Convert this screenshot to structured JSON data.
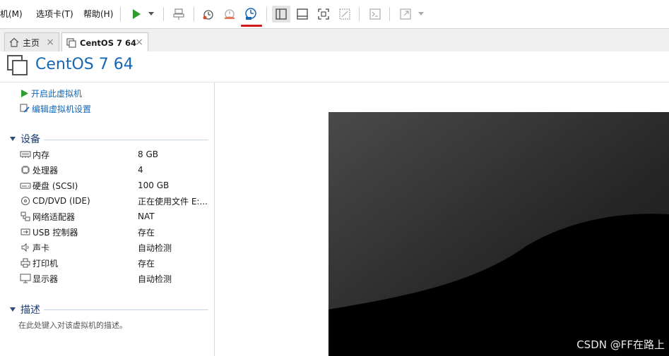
{
  "menu": {
    "vm": "机(M)",
    "tabs": "选项卡(T)",
    "help": "帮助(H)"
  },
  "toolbar": {
    "icons": [
      "play-icon",
      "suspend-icon",
      "snapshot-icon",
      "revert-snapshot-icon",
      "snapshot-manager-icon",
      "show-library-icon",
      "thumbnail-bar-icon",
      "fullscreen-icon",
      "unity-icon",
      "console-icon",
      "stretch-icon"
    ],
    "highlight_color": "#d01818"
  },
  "tabs": [
    {
      "label": "主页",
      "icon": "home-icon",
      "active": false
    },
    {
      "label": "CentOS 7 64",
      "icon": "vm-icon",
      "active": true
    }
  ],
  "vm": {
    "title": "CentOS 7 64",
    "title_color": "#1466b6"
  },
  "actions": {
    "power_on": "开启此虚拟机",
    "edit_settings": "编辑虚拟机设置"
  },
  "devices": {
    "heading": "设备",
    "items": [
      {
        "name": "内存",
        "value": "8 GB",
        "icon": "memory-icon"
      },
      {
        "name": "处理器",
        "value": "4",
        "icon": "cpu-icon"
      },
      {
        "name": "硬盘 (SCSI)",
        "value": "100 GB",
        "icon": "harddisk-icon"
      },
      {
        "name": "CD/DVD (IDE)",
        "value": "正在使用文件 E:...",
        "icon": "cdrom-icon"
      },
      {
        "name": "网络适配器",
        "value": "NAT",
        "icon": "network-icon"
      },
      {
        "name": "USB 控制器",
        "value": "存在",
        "icon": "usb-icon"
      },
      {
        "name": "声卡",
        "value": "自动检测",
        "icon": "sound-icon"
      },
      {
        "name": "打印机",
        "value": "存在",
        "icon": "printer-icon"
      },
      {
        "name": "显示器",
        "value": "自动检测",
        "icon": "display-icon"
      }
    ]
  },
  "description": {
    "heading": "描述",
    "placeholder": "在此处键入对该虚拟机的描述。"
  },
  "watermark": "CSDN @FF在路上"
}
